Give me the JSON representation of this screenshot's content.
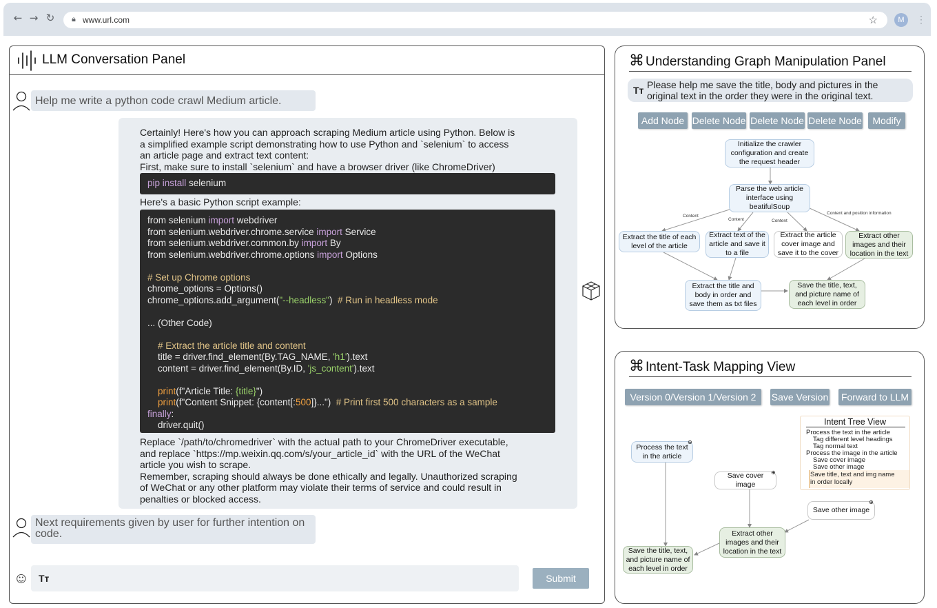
{
  "browser": {
    "url": "www.url.com",
    "avatar_letter": "M"
  },
  "conversation": {
    "title": "LLM Conversation Panel",
    "user_message_1": "Help me write a python code crawl Medium article.",
    "reply": {
      "intro_lines": [
        "Certainly! Here's how you can approach scraping Medium article using Python.  Below is",
        "a simplified example script demonstrating how to use Python and `selenium` to access",
        "an article page and extract text content:",
        "First, make sure to install `selenium` and have a browser driver (like ChromeDriver)"
      ],
      "install_cmd_kw": "pip install",
      "install_cmd_pkg": " selenium",
      "script_intro": "Here's a basic Python script example:",
      "code_lines": [
        {
          "parts": [
            [
              "n",
              "from selenium "
            ],
            [
              "k",
              "import"
            ],
            [
              "n",
              " webdriver"
            ]
          ]
        },
        {
          "parts": [
            [
              "n",
              "from selenium.webdriver.chrome.service "
            ],
            [
              "k",
              "import"
            ],
            [
              "n",
              " Service"
            ]
          ]
        },
        {
          "parts": [
            [
              "n",
              "from selenium.webdriver.common.by "
            ],
            [
              "k",
              "import"
            ],
            [
              "n",
              " By"
            ]
          ]
        },
        {
          "parts": [
            [
              "n",
              "from selenium.webdriver.chrome.options "
            ],
            [
              "k",
              "import"
            ],
            [
              "n",
              " Options"
            ]
          ]
        },
        {
          "parts": []
        },
        {
          "parts": [
            [
              "c",
              "# Set up Chrome options"
            ]
          ]
        },
        {
          "parts": [
            [
              "n",
              "chrome_options = Options()"
            ]
          ]
        },
        {
          "parts": [
            [
              "n",
              "chrome_options.add_argument("
            ],
            [
              "s",
              "\"--headless\""
            ],
            [
              "n",
              ")  "
            ],
            [
              "c",
              "# Run in headless mode"
            ]
          ]
        },
        {
          "parts": []
        },
        {
          "parts": [
            [
              "n",
              "... (Other Code)"
            ]
          ]
        },
        {
          "parts": []
        },
        {
          "parts": [
            [
              "n",
              "    "
            ],
            [
              "c",
              "# Extract the article title and content"
            ]
          ]
        },
        {
          "parts": [
            [
              "n",
              "    title = driver.find_element(By.TAG_NAME, "
            ],
            [
              "s",
              "'h1'"
            ],
            [
              "n",
              ").text"
            ]
          ]
        },
        {
          "parts": [
            [
              "n",
              "    content = driver.find_element(By.ID, "
            ],
            [
              "s",
              "'js_content'"
            ],
            [
              "n",
              ").text"
            ]
          ]
        },
        {
          "parts": []
        },
        {
          "parts": [
            [
              "n",
              "    "
            ],
            [
              "f",
              "print"
            ],
            [
              "n",
              "(f\"Article Title: "
            ],
            [
              "s",
              "{title}"
            ],
            [
              "n",
              "\")"
            ]
          ]
        },
        {
          "parts": [
            [
              "n",
              "    "
            ],
            [
              "f",
              "print"
            ],
            [
              "n",
              "(f\"Content Snippet: {content[:"
            ],
            [
              "f",
              "500"
            ],
            [
              "n",
              "]}...\")  "
            ],
            [
              "c",
              "# Print first 500 characters as a sample"
            ]
          ]
        },
        {
          "parts": [
            [
              "k",
              "finally"
            ],
            [
              "n",
              ":"
            ]
          ]
        },
        {
          "parts": [
            [
              "n",
              "    driver.quit()"
            ]
          ]
        }
      ],
      "outro_lines": [
        "Replace `/path/to/chromedriver` with the actual path to your ChromeDriver executable,",
        "and replace `https://mp.weixin.qq.com/s/your_article_id` with the URL of the WeChat",
        "article you wish to scrape.",
        "Remember, scraping should always be done ethically and legally. Unauthorized scraping",
        "of WeChat or any other platform may violate their terms of service and could result in",
        "penalties or blocked access."
      ]
    },
    "user_message_2": "Next requirements given by user for further intention on code.",
    "input_placeholder": "Tт",
    "submit_label": "Submit"
  },
  "graph_panel": {
    "title": "Understanding Graph Manipulation Panel",
    "prompt": "Please help me save the title, body and pictures in the original text in the order they were in the original text.",
    "buttons": [
      "Add Node",
      "Delete Node",
      "Delete Node",
      "Delete Node",
      "Modify"
    ],
    "nodes": {
      "n1": "Initialize the crawler configuration and create the request header",
      "n2": "Parse the web article interface using beatifulSoup",
      "n3": "Extract the title of each level of the article",
      "n4": "Extract  text  of the article and save it to a file",
      "n5": "Extract the article cover image and save it to the cover",
      "n6": "Extract other images and their location in the text",
      "n7": "Extract the title and body in order and save them as txt files",
      "n8": "Save the title, text, and picture name of each level in order"
    },
    "edge_labels": {
      "e1": "Content",
      "e2": "Content",
      "e3": "Content",
      "e4": "Content and position information"
    }
  },
  "intent_panel": {
    "title": "Intent-Task Mapping View",
    "buttons": [
      "Version 0/Version 1/Version 2",
      "Save Version",
      "Forward to LLM"
    ],
    "tree": {
      "title": "Intent Tree View",
      "items": [
        "Process the text in the article",
        "Tag different level headings",
        "Tag normal text",
        "Process the image in the article",
        "Save cover image",
        "Save other image",
        "Save title, text and img name",
        "in order locally"
      ]
    },
    "nodes": {
      "a": "Process the text in the article",
      "b": "Save cover image",
      "c": "Save other image",
      "d": "Extract other images and their location in the text",
      "e": "Save the title, text, and picture name of each level in order"
    }
  }
}
